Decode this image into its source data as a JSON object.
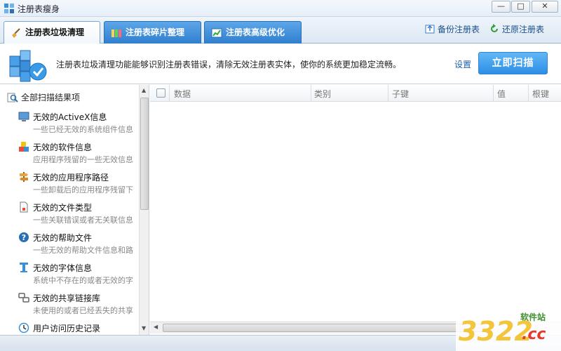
{
  "window": {
    "title": "注册表瘦身",
    "minimize": "—",
    "maximize": "□",
    "close": "✕"
  },
  "tabs": [
    {
      "label": "注册表垃圾清理",
      "active": true,
      "icon": "broom-icon"
    },
    {
      "label": "注册表碎片整理",
      "active": false,
      "icon": "defrag-icon"
    },
    {
      "label": "注册表高级优化",
      "active": false,
      "icon": "chart-icon"
    }
  ],
  "toplinks": {
    "backup": "备份注册表",
    "restore": "还原注册表"
  },
  "header": {
    "description": "注册表垃圾清理功能能够识别注册表错误，清除无效注册表实体，使你的系统更加稳定流畅。",
    "settings": "设置",
    "scan_button": "立即扫描"
  },
  "left": {
    "all_results": "全部扫描结果项",
    "categories": [
      {
        "name": "无效的ActiveX信息",
        "desc": "一些已经无效的系统组件信息",
        "icon": "monitor-icon"
      },
      {
        "name": "无效的软件信息",
        "desc": "应用程序残留的一些无效信息",
        "icon": "software-icon"
      },
      {
        "name": "无效的应用程序路径",
        "desc": "一些卸载后的应用程序残留下",
        "icon": "path-sign-icon"
      },
      {
        "name": "无效的文件类型",
        "desc": "一些关联错误或者无关联信息",
        "icon": "file-type-icon"
      },
      {
        "name": "无效的帮助文件",
        "desc": "一些无效的帮助文件信息和路",
        "icon": "help-icon"
      },
      {
        "name": "无效的字体信息",
        "desc": "系统中不存在的或者无效的字",
        "icon": "font-icon"
      },
      {
        "name": "无效的共享链接库",
        "desc": "未使用的或者已经丢失的共享",
        "icon": "shared-library-icon"
      },
      {
        "name": "用户访问历史记录",
        "desc": "",
        "icon": "history-icon"
      }
    ]
  },
  "table": {
    "columns": [
      "数据",
      "类别",
      "子键",
      "值",
      "根键"
    ]
  },
  "watermark": {
    "number": "3322",
    "domain": ".cc",
    "site": "软件站"
  },
  "colors": {
    "accent": "#2b8ee6",
    "tab_inactive": "#3d8ad8",
    "link": "#1a5fa8"
  }
}
